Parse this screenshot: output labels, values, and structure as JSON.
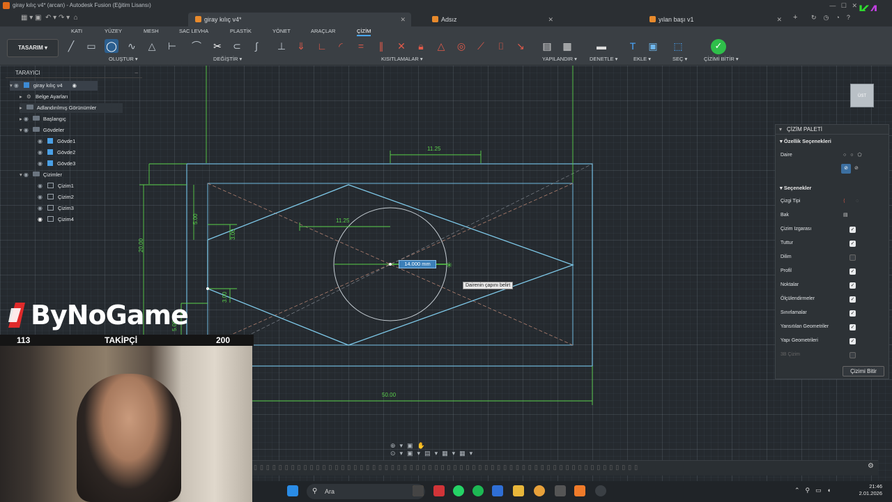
{
  "window": {
    "title": "giray kılıç v4* (arcan) - Autodesk Fusion (Eğitim Lisansı)"
  },
  "tabs": [
    {
      "label": "giray kılıç v4*",
      "active": true
    },
    {
      "label": "Adsız",
      "active": false
    },
    {
      "label": "yılan başı v1",
      "active": false
    }
  ],
  "ribbon": {
    "workspace": "TASARIM",
    "tabs": [
      "KATI",
      "YÜZEY",
      "MESH",
      "SAC LEVHA",
      "PLASTİK",
      "YÖNET",
      "ARAÇLAR",
      "ÇİZİM"
    ],
    "active_tab": "ÇİZİM",
    "groups": [
      "OLUŞTUR ▾",
      "DEĞİŞTİR ▾",
      "KISITLAMALAR ▾",
      "YAPILANDIR ▾",
      "DENETLE ▾",
      "EKLE ▾",
      "SEÇ ▾",
      "ÇİZİMİ BİTİR ▾"
    ]
  },
  "browser": {
    "title": "TARAYICI",
    "items": [
      {
        "label": "giray kılıç v4",
        "kind": "root"
      },
      {
        "label": "Belge Ayarları",
        "kind": "settings"
      },
      {
        "label": "Adlandırılmış Görünümler",
        "kind": "folder"
      },
      {
        "label": "Başlangıç",
        "kind": "folder"
      },
      {
        "label": "Gövdeler",
        "kind": "folder"
      },
      {
        "label": "Gövde1",
        "kind": "body"
      },
      {
        "label": "Gövde2",
        "kind": "body"
      },
      {
        "label": "Gövde3",
        "kind": "body"
      },
      {
        "label": "Çizimler",
        "kind": "folder"
      },
      {
        "label": "Çizim1",
        "kind": "sketch"
      },
      {
        "label": "Çizim2",
        "kind": "sketch"
      },
      {
        "label": "Çizim3",
        "kind": "sketch"
      },
      {
        "label": "Çizim4",
        "kind": "sketch"
      }
    ]
  },
  "canvas": {
    "dimensions": [
      "11.25",
      "11.25",
      "50.00",
      "20.00",
      "5.00",
      "5.00",
      "3.00",
      "3.00"
    ],
    "dim_input": "14.000 mm",
    "tooltip": "Dairenin çapını belirt",
    "viewcube": "ÜST"
  },
  "palette": {
    "title": "ÇİZİM PALETİ",
    "feature_section": "Özellik Seçenekleri",
    "daire_label": "Daire",
    "options_section": "Seçenekler",
    "line_type_label": "Çizgi Tipi",
    "look_label": "Bak",
    "options": [
      {
        "label": "Çizim Izgarası",
        "checked": true
      },
      {
        "label": "Tuttur",
        "checked": true
      },
      {
        "label": "Dilim",
        "checked": false
      },
      {
        "label": "Profil",
        "checked": true
      },
      {
        "label": "Noktalar",
        "checked": true
      },
      {
        "label": "Ölçülendirmeler",
        "checked": true
      },
      {
        "label": "Sınırlamalar",
        "checked": true
      },
      {
        "label": "Yansıtılan Geometriler",
        "checked": true
      },
      {
        "label": "Yapı Geometrileri",
        "checked": true
      },
      {
        "label": "3B Çizim",
        "checked": false
      }
    ],
    "finish_button": "Çizimi Bitir"
  },
  "overlay": {
    "brand": "ByNoGame",
    "followers_current": "113",
    "followers_label": "TAKİPÇİ",
    "followers_goal": "200"
  },
  "taskbar": {
    "search_placeholder": "Ara",
    "time": "21:46",
    "date": "2.01.2026"
  },
  "colors": {
    "accent": "#4aa8ff",
    "sketch_line": "#7ec8e8",
    "dimension": "#59d04a",
    "finish_green": "#2fbf4a"
  }
}
